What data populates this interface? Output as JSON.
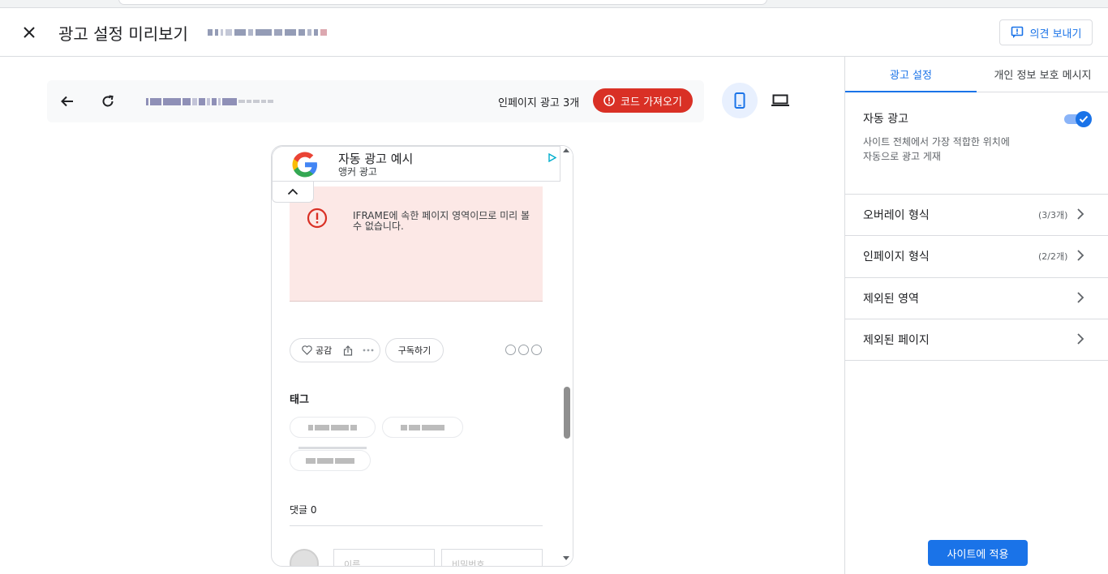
{
  "header": {
    "title": "광고 설정 미리보기",
    "feedback_label": "의견 보내기"
  },
  "toolbar": {
    "inpage_ad_count": "인페이지 광고 3개",
    "get_code_label": "코드 가져오기"
  },
  "anchor_ad": {
    "title": "자동 광고 예시",
    "subtitle": "앵커 광고"
  },
  "preview": {
    "iframe_message": "IFRAME에 속한 페이지 영역이므로 미리 볼 수 없습니다.",
    "like_label": "공감",
    "subscribe_label": "구독하기",
    "tag_heading": "태그",
    "comments_label": "댓글 0",
    "name_placeholder": "이름",
    "password_placeholder": "비밀번호"
  },
  "panel": {
    "tabs": [
      {
        "label": "광고 설정",
        "active": true
      },
      {
        "label": "개인 정보 보호 메시지",
        "active": false
      }
    ],
    "auto_ads": {
      "title": "자동 광고",
      "description_line1": "사이트 전체에서 가장 적합한 위치에",
      "description_line2": "자동으로 광고 게재",
      "enabled": true
    },
    "rows": [
      {
        "label": "오버레이 형식",
        "count": "(3/3개)"
      },
      {
        "label": "인페이지 형식",
        "count": "(2/2개)"
      },
      {
        "label": "제외된 영역",
        "count": ""
      },
      {
        "label": "제외된 페이지",
        "count": ""
      }
    ],
    "apply_label": "사이트에 적용"
  },
  "colors": {
    "accent": "#1a73e8",
    "danger": "#d93025",
    "iframe_bg": "#fce8e6"
  }
}
